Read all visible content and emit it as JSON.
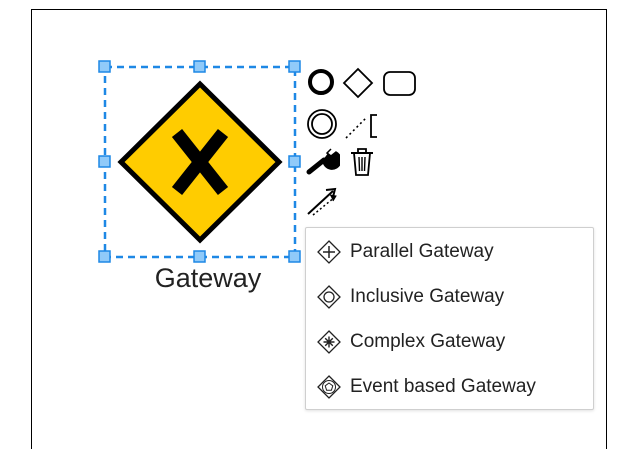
{
  "element": {
    "label": "Gateway",
    "type": "exclusive-gateway",
    "fill_color": "#FFCC00",
    "stroke_color": "#000000",
    "selection_color": "#1E88E5"
  },
  "context_pad": {
    "icons": [
      "start-event-icon",
      "gateway-icon",
      "task-icon",
      "intermediate-event-icon",
      "text-annotation-icon",
      "wrench-icon",
      "trash-icon",
      "connect-icon"
    ]
  },
  "replace_menu": {
    "items": [
      {
        "label": "Parallel Gateway",
        "icon": "parallel-gateway-icon"
      },
      {
        "label": "Inclusive Gateway",
        "icon": "inclusive-gateway-icon"
      },
      {
        "label": "Complex Gateway",
        "icon": "complex-gateway-icon"
      },
      {
        "label": "Event based Gateway",
        "icon": "event-based-gateway-icon"
      }
    ]
  }
}
